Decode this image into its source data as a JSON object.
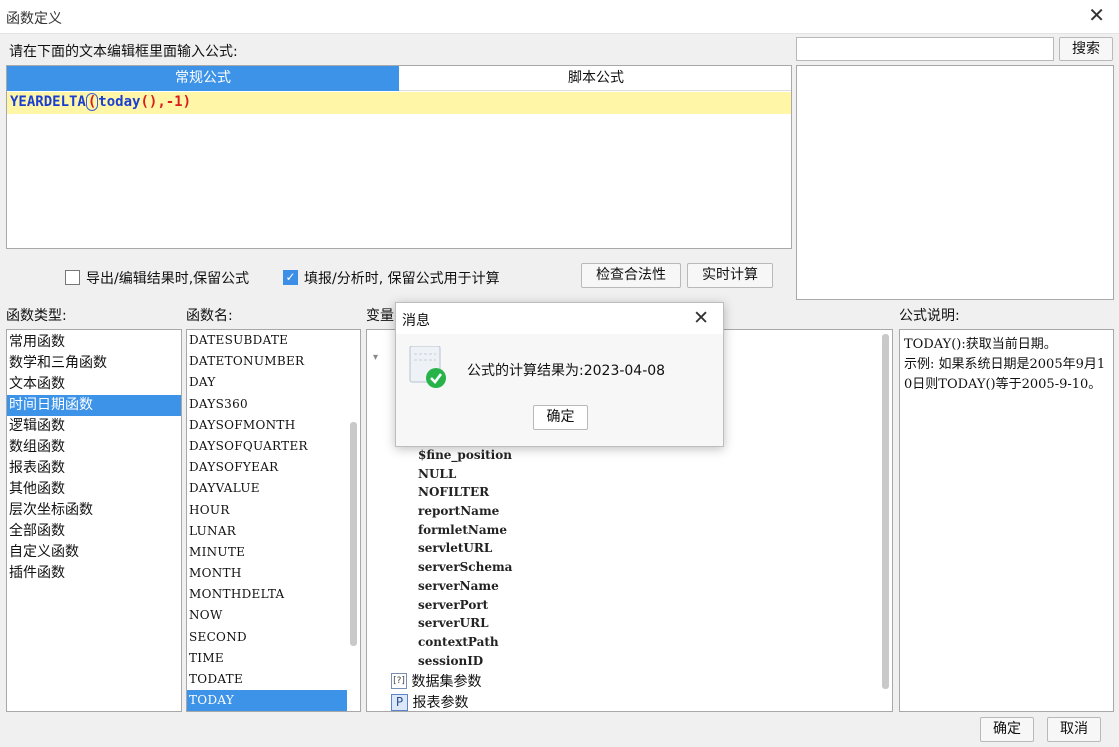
{
  "window": {
    "title": "函数定义"
  },
  "editor": {
    "prompt_label": "请在下面的文本编辑框里面输入公式:",
    "tabs": [
      "常规公式",
      "脚本公式"
    ],
    "formula": {
      "func": "YEARDELTA",
      "open": "(",
      "arg": "today",
      "call": "()",
      "rest": ",-1)"
    }
  },
  "search": {
    "value": "",
    "button_label": "搜索"
  },
  "options": {
    "export_keep": {
      "label": "导出/编辑结果时,保留公式",
      "checked": false
    },
    "fill_keep": {
      "label": "填报/分析时, 保留公式用于计算",
      "checked": true
    },
    "check_button": "检查合法性",
    "realtime_button": "实时计算"
  },
  "func_types": {
    "label": "函数类型:",
    "items": [
      "常用函数",
      "数学和三角函数",
      "文本函数",
      "时间日期函数",
      "逻辑函数",
      "数组函数",
      "报表函数",
      "其他函数",
      "层次坐标函数",
      "全部函数",
      "自定义函数",
      "插件函数"
    ],
    "selected": "时间日期函数"
  },
  "func_names": {
    "label": "函数名:",
    "items": [
      "DATESUBDATE",
      "DATETONUMBER",
      "DAY",
      "DAYS360",
      "DAYSOFMONTH",
      "DAYSOFQUARTER",
      "DAYSOFYEAR",
      "DAYVALUE",
      "HOUR",
      "LUNAR",
      "MINUTE",
      "MONTH",
      "MONTHDELTA",
      "NOW",
      "SECOND",
      "TIME",
      "TODATE",
      "TODAY"
    ],
    "selected": "TODAY"
  },
  "variables": {
    "label": "变量",
    "items": [
      "$fine_position",
      "NULL",
      "NOFILTER",
      "reportName",
      "formletName",
      "servletURL",
      "serverSchema",
      "serverName",
      "serverPort",
      "serverURL",
      "contextPath",
      "sessionID"
    ],
    "groups": [
      "数据集参数",
      "报表参数"
    ]
  },
  "description": {
    "label": "公式说明:",
    "text": "TODAY():获取当前日期。\n示例: 如果系统日期是2005年9月10日则TODAY()等于2005-9-10。"
  },
  "dialog": {
    "title": "消息",
    "message": "公式的计算结果为:2023-04-08",
    "ok": "确定"
  },
  "footer": {
    "ok": "确定",
    "cancel": "取消"
  },
  "colors": {
    "accent": "#3d93e8",
    "editor_highlight": "#fff6a8",
    "func_color": "#1a3fd0",
    "number_color": "#d81e1e",
    "success": "#27b34a"
  }
}
